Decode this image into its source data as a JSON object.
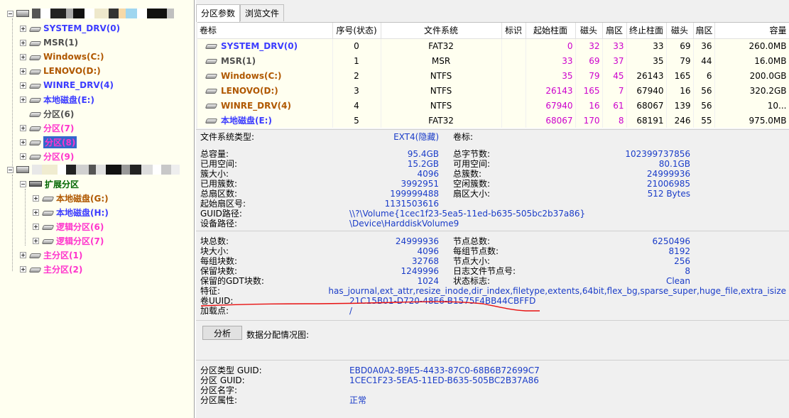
{
  "tree": {
    "disk1_items": [
      {
        "label": "SYSTEM_DRV(0)",
        "color": "#3c3cff"
      },
      {
        "label": "MSR(1)",
        "color": "#505050"
      },
      {
        "label": "Windows(C:)",
        "color": "#b05800"
      },
      {
        "label": "LENOVO(D:)",
        "color": "#b05800"
      },
      {
        "label": "WINRE_DRV(4)",
        "color": "#3c3cff"
      },
      {
        "label": "本地磁盘(E:)",
        "color": "#3c3cff"
      },
      {
        "label": "分区(6)",
        "color": "#505050"
      },
      {
        "label": "分区(7)",
        "color": "#ff33cc"
      },
      {
        "label": "分区(8)",
        "color": "#ff33cc",
        "selected": true
      },
      {
        "label": "分区(9)",
        "color": "#ff33cc"
      }
    ],
    "extended_label": "扩展分区",
    "extended_items": [
      {
        "label": "本地磁盘(G:)",
        "color": "#b05800"
      },
      {
        "label": "本地磁盘(H:)",
        "color": "#3c3cff"
      },
      {
        "label": "逻辑分区(6)",
        "color": "#ff33cc"
      },
      {
        "label": "逻辑分区(7)",
        "color": "#ff33cc"
      }
    ],
    "primary_items": [
      {
        "label": "主分区(1)",
        "color": "#ff33cc"
      },
      {
        "label": "主分区(2)",
        "color": "#ff33cc"
      }
    ]
  },
  "tabs": {
    "partition_params": "分区参数",
    "browse_files": "浏览文件"
  },
  "grid": {
    "headers": [
      "卷标",
      "序号(状态)",
      "文件系统",
      "标识",
      "起始柱面",
      "磁头",
      "扇区",
      "终止柱面",
      "磁头",
      "扇区",
      "容量"
    ],
    "rows": [
      {
        "name": "SYSTEM_DRV(0)",
        "color": "#3c3cff",
        "idx": "0",
        "fs": "FAT32",
        "flag": "",
        "sc": "0",
        "sh": "32",
        "ss": "33",
        "ec": "33",
        "eh": "69",
        "es": "36",
        "cap": "260.0MB"
      },
      {
        "name": "MSR(1)",
        "color": "#505050",
        "idx": "1",
        "fs": "MSR",
        "flag": "",
        "sc": "33",
        "sh": "69",
        "ss": "37",
        "ec": "35",
        "eh": "79",
        "es": "44",
        "cap": "16.0MB"
      },
      {
        "name": "Windows(C:)",
        "color": "#b05800",
        "idx": "2",
        "fs": "NTFS",
        "flag": "",
        "sc": "35",
        "sh": "79",
        "ss": "45",
        "ec": "26143",
        "eh": "165",
        "es": "6",
        "cap": "200.0GB"
      },
      {
        "name": "LENOVO(D:)",
        "color": "#b05800",
        "idx": "3",
        "fs": "NTFS",
        "flag": "",
        "sc": "26143",
        "sh": "165",
        "ss": "7",
        "ec": "67940",
        "eh": "16",
        "es": "56",
        "cap": "320.2GB"
      },
      {
        "name": "WINRE_DRV(4)",
        "color": "#b05800",
        "idx": "4",
        "fs": "NTFS",
        "flag": "",
        "sc": "67940",
        "sh": "16",
        "ss": "61",
        "ec": "68067",
        "eh": "139",
        "es": "56",
        "cap": "10..."
      },
      {
        "name": "本地磁盘(E:)",
        "color": "#3c3cff",
        "idx": "5",
        "fs": "FAT32",
        "flag": "",
        "sc": "68067",
        "sh": "170",
        "ss": "8",
        "ec": "68191",
        "eh": "246",
        "es": "55",
        "cap": "975.0MB"
      }
    ]
  },
  "fs_section": {
    "type_label": "文件系统类型:",
    "type_value": "EXT4(隐藏)",
    "vol_label": "卷标:",
    "rows": [
      {
        "k1": "总容量:",
        "v1": "95.4GB",
        "k2": "总字节数:",
        "v2": "102399737856"
      },
      {
        "k1": "已用空间:",
        "v1": "15.2GB",
        "k2": "可用空间:",
        "v2": "80.1GB"
      },
      {
        "k1": "簇大小:",
        "v1": "4096",
        "k2": "总簇数:",
        "v2": "24999936"
      },
      {
        "k1": "已用簇数:",
        "v1": "3992951",
        "k2": "空闲簇数:",
        "v2": "21006985"
      },
      {
        "k1": "总扇区数:",
        "v1": "199999488",
        "k2": "扇区大小:",
        "v2": "512 Bytes"
      },
      {
        "k1": "起始扇区号:",
        "v1": "1131503616",
        "k2": "",
        "v2": ""
      }
    ],
    "guid_path_label": "GUID路径:",
    "guid_path": "\\\\?\\Volume{1cec1f23-5ea5-11ed-b635-505bc2b37a86}",
    "device_path_label": "设备路径:",
    "device_path": "\\Device\\HarddiskVolume9"
  },
  "ext_section": {
    "rows": [
      {
        "k1": "块总数:",
        "v1": "24999936",
        "k2": "节点总数:",
        "v2": "6250496"
      },
      {
        "k1": "块大小:",
        "v1": "4096",
        "k2": "每组节点数:",
        "v2": "8192"
      },
      {
        "k1": "每组块数:",
        "v1": "32768",
        "k2": "节点大小:",
        "v2": "256"
      },
      {
        "k1": "保留块数:",
        "v1": "1249996",
        "k2": "日志文件节点号:",
        "v2": "8"
      },
      {
        "k1": "保留的GDT块数:",
        "v1": "1024",
        "k2": "状态标志:",
        "v2": "Clean"
      }
    ],
    "features_label": "特征:",
    "features": "has_journal,ext_attr,resize_inode,dir_index,filetype,extents,64bit,flex_bg,sparse_super,huge_file,extra_isize",
    "uuid_label": "卷UUID:",
    "uuid": "21C15B01-D720-48E6-B1575F4BB44CBFFD",
    "mount_label": "加载点:",
    "mount": "/"
  },
  "analyze": {
    "button": "分析",
    "dist_label": "数据分配情况图:"
  },
  "guid_section": {
    "rows": [
      {
        "k": "分区类型 GUID:",
        "v": "EBD0A0A2-B9E5-4433-87C0-68B6B72699C7"
      },
      {
        "k": "分区 GUID:",
        "v": "1CEC1F23-5EA5-11ED-B635-505BC2B37A86"
      },
      {
        "k": "分区名字:",
        "v": ""
      },
      {
        "k": "分区属性:",
        "v": "正常"
      }
    ]
  }
}
